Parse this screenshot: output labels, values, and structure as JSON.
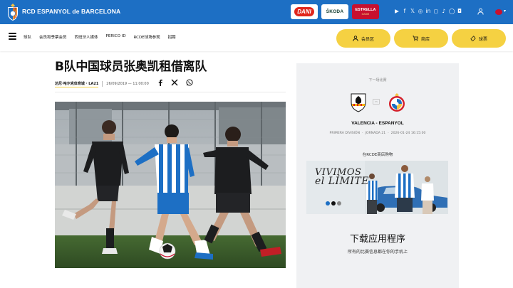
{
  "header": {
    "club_name": "RCD ESPANYOL de BARCELONA",
    "sponsors": [
      {
        "name": "DANI"
      },
      {
        "name": "ŠKODA"
      },
      {
        "name": "ESTRELLA",
        "sub": "DAMM"
      }
    ],
    "social_icons": [
      "youtube-icon",
      "facebook-icon",
      "x-icon",
      "instagram-icon",
      "linkedin-icon",
      "twitch-icon",
      "tiktok-icon",
      "whatsapp-icon",
      "discord-icon"
    ],
    "brand_color": "#1d6fc4"
  },
  "nav": {
    "links": [
      "球队",
      "会员和季票会员",
      "西班牙人媒体",
      "PERICO ID",
      "RCDE球场参观",
      "招聘"
    ],
    "buttons": [
      "会员区",
      "商店",
      "球票"
    ],
    "button_color": "#f5d142"
  },
  "article": {
    "title": "B队中国球员张奥凯租借离队",
    "author": "达尼·哈尔克体育城 · LA21",
    "date": "26/09/2019 — 11:00:00"
  },
  "sidebar": {
    "next_match_label": "下一场比赛",
    "home_team": "VALENCIA",
    "away_team": "ESPANYOL",
    "match_title": "VALENCIA - ESPANYOL",
    "competition": "PRIMERA DIVISIÓN",
    "round": "JORNADA 21",
    "datetime": "2026-01-24 16:15:00",
    "shop_label": "在RCDE商店购物",
    "banner_line1": "VIVIMOS",
    "banner_line2": "el LÍMITE",
    "app_title": "下载应用程序",
    "app_subtitle": "所有的比赛信息都在你的手机上"
  }
}
